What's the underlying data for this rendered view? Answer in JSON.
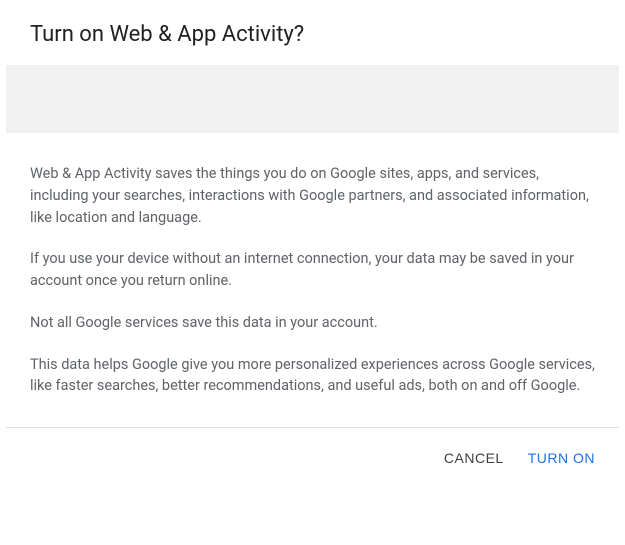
{
  "dialog": {
    "title": "Turn on Web & App Activity?",
    "paragraphs": [
      "Web & App Activity saves the things you do on Google sites, apps, and services, including your searches, interactions with Google partners, and associated information, like location and language.",
      "If you use your device without an internet connection, your data may be saved in your account once you return online.",
      "Not all Google services save this data in your account.",
      "This data helps Google give you more personalized experiences across Google services, like faster searches, better recommendations, and useful ads, both on and off Google."
    ],
    "actions": {
      "cancel": "CANCEL",
      "confirm": "TURN ON"
    }
  }
}
